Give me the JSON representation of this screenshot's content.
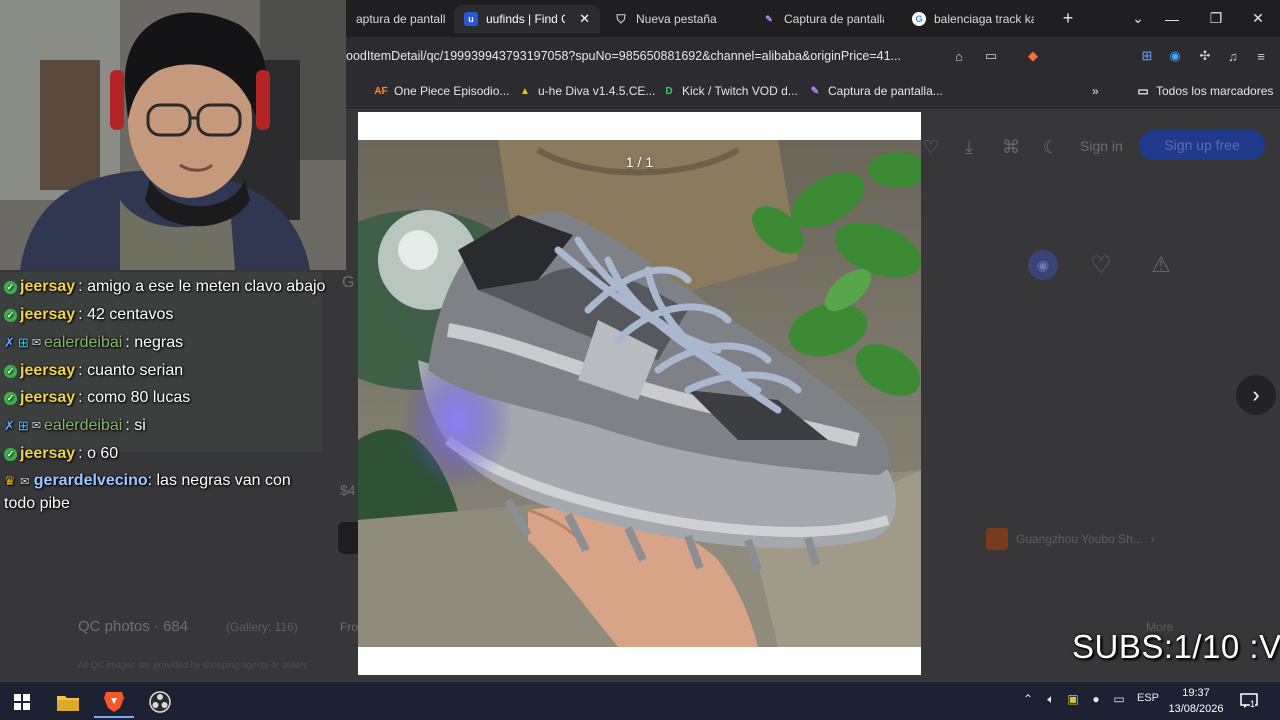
{
  "browser": {
    "tabs": [
      {
        "label": "aptura de pantalla",
        "icon": "pen-icon"
      },
      {
        "label": "uufinds | Find Q",
        "icon": "uufinds-icon",
        "active": true
      },
      {
        "label": "Nueva pestaña",
        "icon": "shield-icon"
      },
      {
        "label": "Captura de pantalla",
        "icon": "pen-icon"
      },
      {
        "label": "balenciaga track kak",
        "icon": "google-icon"
      }
    ],
    "close_tab_symbol": "✕",
    "new_tab_symbol": "+",
    "url": "oodItemDetail/qc/199939943793197058?spuNo=985650881692&channel=alibaba&originPrice=41...",
    "bookmarks": [
      {
        "label": "One Piece Episodio...",
        "icon": "AF"
      },
      {
        "label": "u-he Diva v1.4.5.CE...",
        "icon": "drive"
      },
      {
        "label": "Kick / Twitch VOD d...",
        "icon": "D"
      },
      {
        "label": "Captura de pantalla...",
        "icon": "pen"
      }
    ],
    "bookmarks_more": "»",
    "all_bookmarks": "Todos los marcadores"
  },
  "page": {
    "sign_in": "Sign in",
    "sign_up": "Sign up free",
    "qc_photos": "QC photos · 684",
    "gallery": "(Gallery: 116)",
    "disclaimer": "All QC images are provided by shopping agents or sellers",
    "seller": "Guangzhou Youbo Sh...",
    "more": "More",
    "fragment_g": "G",
    "fragment_fro": "Fro",
    "fragment_dollar": "$4"
  },
  "lightbox": {
    "counter": "1 / 1",
    "next_symbol": "›"
  },
  "chat": {
    "messages": [
      {
        "user": "jeersay",
        "text": ": amigo a ese le meten clavo abajo",
        "user_color": "#f2d34a",
        "badges": [
          "check"
        ]
      },
      {
        "user": "jeersay",
        "text": ": 42 centavos",
        "user_color": "#f2d34a",
        "badges": [
          "check"
        ]
      },
      {
        "user": "ealerdeibai",
        "text": ": negras",
        "user_color": "#86b86a",
        "badges": [
          "sword",
          "grid",
          "mail"
        ]
      },
      {
        "user": "jeersay",
        "text": ": cuanto serian",
        "user_color": "#f2d34a",
        "badges": [
          "check"
        ]
      },
      {
        "user": "jeersay",
        "text": ": como 80 lucas",
        "user_color": "#f2d34a",
        "badges": [
          "check"
        ]
      },
      {
        "user": "ealerdeibai",
        "text": ": si",
        "user_color": "#86b86a",
        "badges": [
          "sword",
          "grid",
          "mail"
        ]
      },
      {
        "user": "jeersay",
        "text": ": o 60",
        "user_color": "#f2d34a",
        "badges": [
          "check"
        ]
      },
      {
        "user": "gerardelvecino",
        "text": ": las negras van con todo pibe",
        "user_color": "#9ec8ff",
        "badges": [
          "crown",
          "mail"
        ]
      }
    ]
  },
  "overlay": {
    "subs": "SUBS:1/10 :V"
  },
  "taskbar": {
    "language": "ESP",
    "time": "19:37",
    "date": "13/08/2026",
    "notification_count": "1"
  },
  "colors": {
    "signup_bg": "#1f3a8c",
    "taskbar_bg": "#1c2231",
    "check_badge": "#3db34a"
  }
}
